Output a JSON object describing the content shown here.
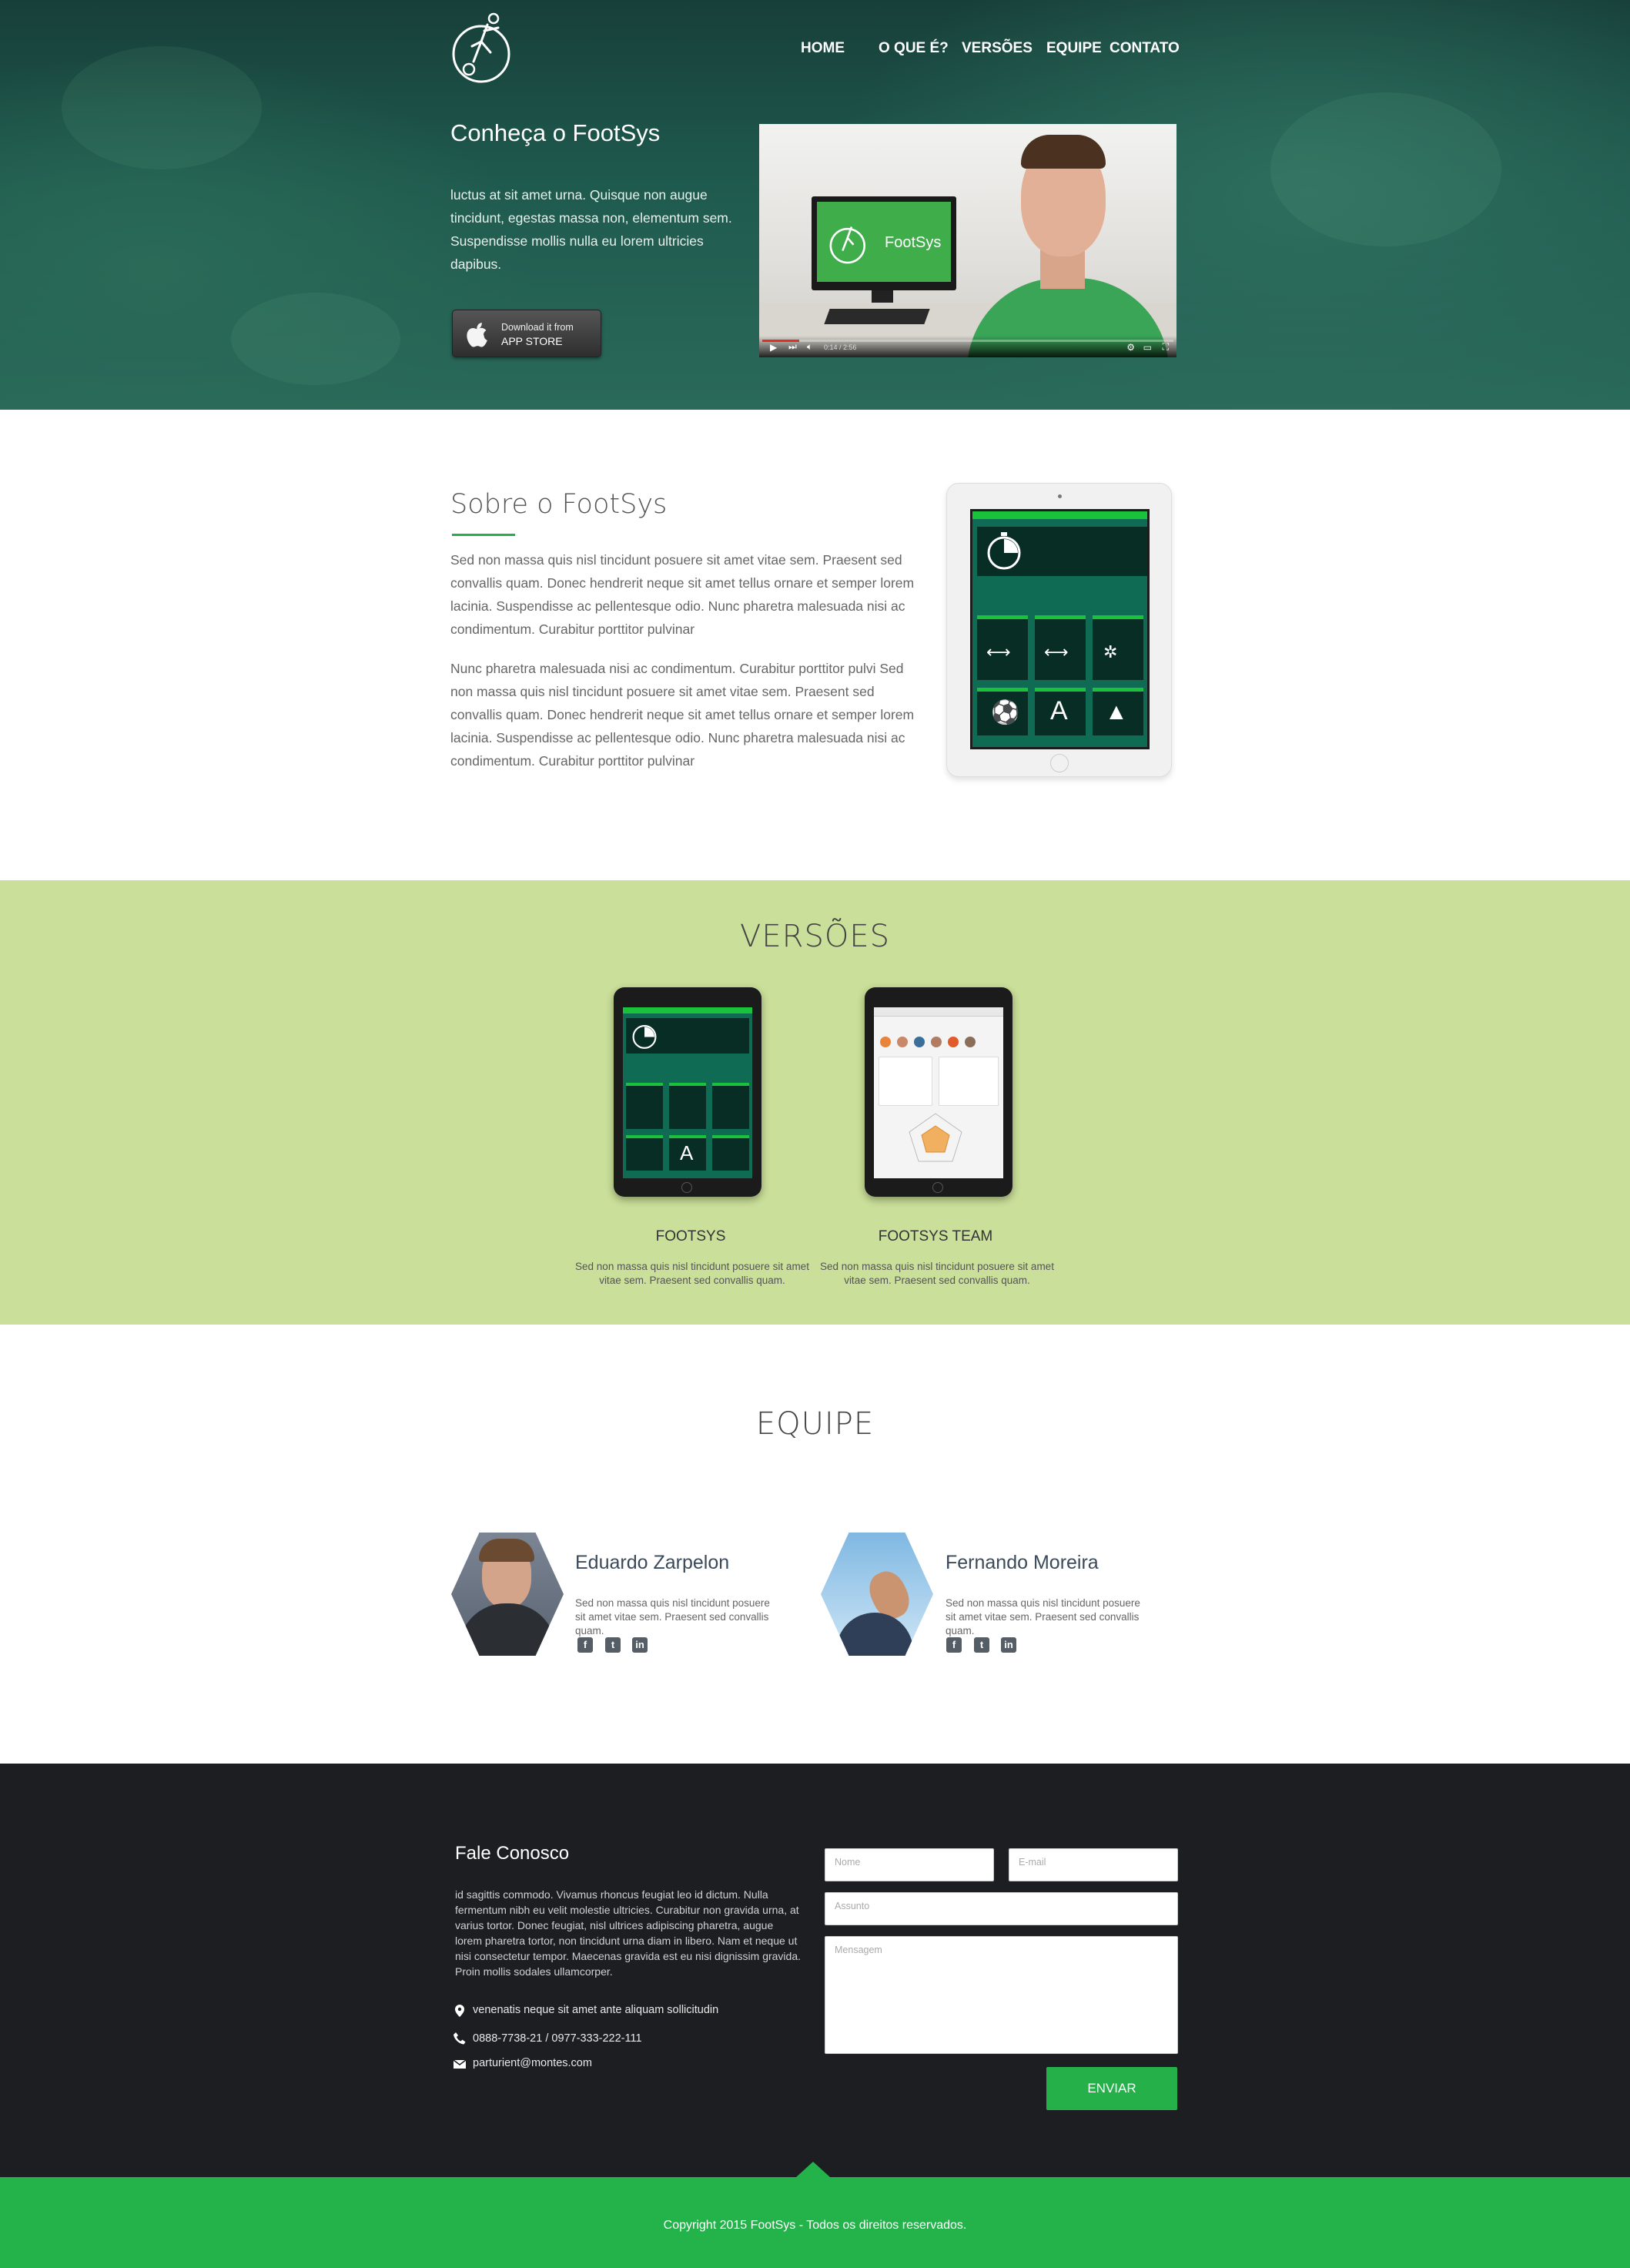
{
  "nav": {
    "home": "HOME",
    "oque": "O QUE É?",
    "versoes": "VERSÕES",
    "equipe": "EQUIPE",
    "contato": "CONTATO"
  },
  "hero": {
    "title": "Conheça o FootSys",
    "text": "luctus at sit amet urna. Quisque non augue tincidunt, egestas massa non, elementum sem. Suspendisse mollis nulla eu lorem ultricies dapibus.",
    "store_line1": "Download it from",
    "store_line2": "APP STORE",
    "video_screen_label": "FootSys",
    "video_time": "0:14 / 2:56",
    "video_progress": 0.09
  },
  "sobre": {
    "title": "Sobre o FootSys",
    "p1": "Sed non massa quis nisl tincidunt posuere sit amet vitae sem. Praesent sed convallis quam. Donec hendrerit neque sit amet tellus ornare et semper lorem lacinia. Suspendisse ac pellentesque odio. Nunc pharetra malesuada nisi ac condimentum. Curabitur porttitor pulvinar",
    "p2": "Nunc pharetra malesuada nisi ac condimentum. Curabitur porttitor pulvi Sed non massa quis nisl tincidunt posuere sit amet vitae sem. Praesent sed convallis quam. Donec hendrerit neque sit amet tellus ornare et semper lorem lacinia. Suspendisse ac pellentesque odio. Nunc pharetra malesuada nisi ac condimentum. Curabitur porttitor pulvinar"
  },
  "versoes": {
    "title": "VERSÕES",
    "items": [
      {
        "name": "FOOTSYS",
        "desc": "Sed non massa quis nisl tincidunt posuere sit amet vitae sem. Praesent sed convallis quam."
      },
      {
        "name": "FOOTSYS TEAM",
        "desc": "Sed non massa quis nisl tincidunt posuere sit amet vitae sem. Praesent sed convallis quam."
      }
    ]
  },
  "equipe": {
    "title": "EQUIPE",
    "members": [
      {
        "name": "Eduardo Zarpelon",
        "desc": "Sed non massa quis nisl tincidunt posuere sit amet vitae sem. Praesent sed convallis quam."
      },
      {
        "name": "Fernando Moreira",
        "desc": "Sed non massa quis nisl tincidunt posuere sit amet vitae sem. Praesent sed convallis quam."
      }
    ],
    "social_icons": [
      "facebook-icon",
      "twitter-icon",
      "linkedin-icon"
    ]
  },
  "contato": {
    "title": "Fale Conosco",
    "text": "id sagittis commodo. Vivamus rhoncus feugiat leo id dictum. Nulla fermentum nibh eu velit molestie ultricies. Curabitur non gravida urna, at varius tortor. Donec feugiat, nisl ultrices adipiscing pharetra, augue lorem pharetra tortor, non tincidunt urna diam in libero. Nam et neque ut nisi consectetur tempor. Maecenas gravida est eu nisi dignissim gravida. Proin mollis sodales ullamcorper.",
    "address": "venenatis neque sit amet ante aliquam sollicitudin",
    "phone": "0888-7738-21   /   0977-333-222-111",
    "email": "parturient@montes.com",
    "placeholders": {
      "nome": "Nome",
      "email": "E-mail",
      "assunto": "Assunto",
      "mensagem": "Mensagem"
    },
    "send_label": "ENVIAR"
  },
  "footer": {
    "copyright": "Copyright 2015 FootSys - Todos os direitos reservados."
  },
  "colors": {
    "brand_green": "#24b24b",
    "hero_teal": "#1f5a4e",
    "versoes_bg": "#cadf99",
    "footer_dark": "#1d1e21"
  }
}
